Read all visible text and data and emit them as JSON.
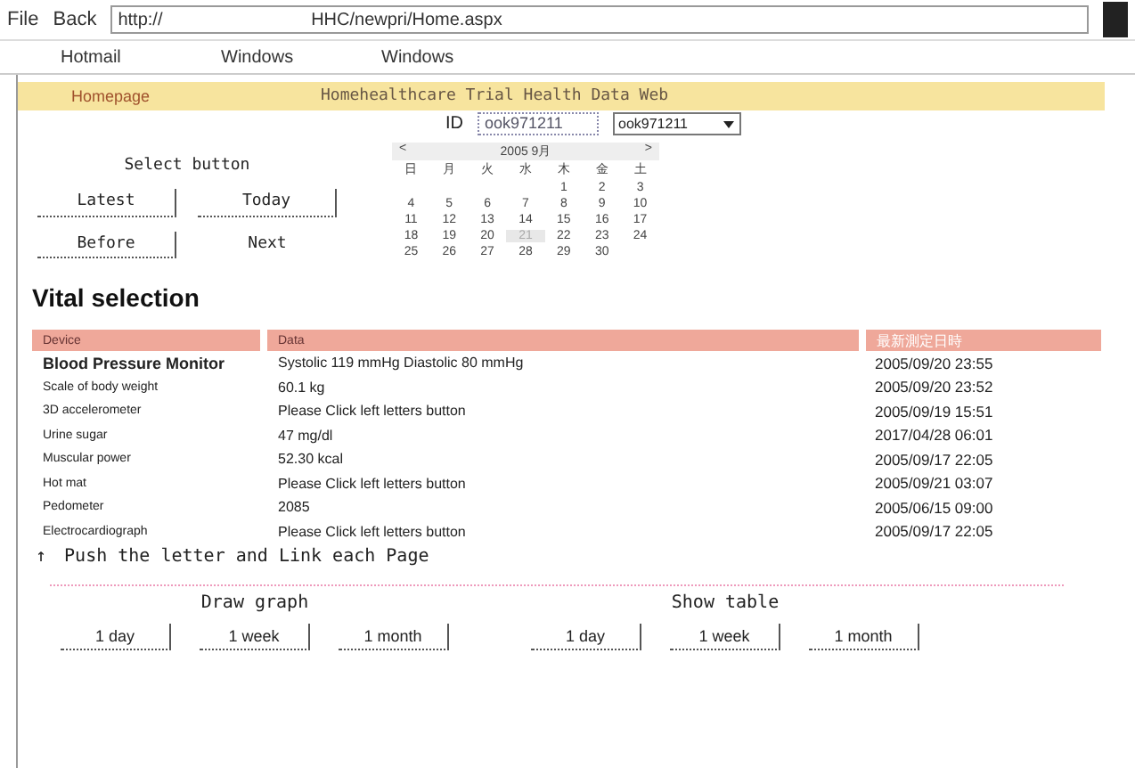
{
  "browser": {
    "menu": "File",
    "back": "Back",
    "address": "http://                              HHC/newpri/Home.aspx",
    "links": [
      "Hotmail",
      "Windows",
      "Windows"
    ]
  },
  "header": {
    "home_link": "Homepage",
    "title": "Homehealthcare Trial   Health Data Web"
  },
  "id_row": {
    "label": "ID",
    "value": "ook971211",
    "select": "ook971211"
  },
  "select_panel": {
    "caption": "Select button",
    "buttons": [
      {
        "label": "Latest",
        "kind": "button"
      },
      {
        "label": "Today",
        "kind": "button"
      },
      {
        "label": "Before",
        "kind": "button"
      },
      {
        "label": "Next",
        "kind": "text"
      }
    ]
  },
  "calendar": {
    "prev": "<",
    "month": "2005 9月",
    "next": ">",
    "weekdays": [
      "日",
      "月",
      "火",
      "水",
      "木",
      "金",
      "土"
    ],
    "weeks": [
      [
        {
          "day": "1",
          "selected": false
        },
        {
          "day": "2",
          "selected": false
        },
        {
          "day": "3",
          "selected": false
        }
      ],
      [
        {
          "day": "4",
          "selected": false
        },
        {
          "day": "5",
          "selected": false
        },
        {
          "day": "6",
          "selected": false
        },
        {
          "day": "7",
          "selected": false
        },
        {
          "day": "8",
          "selected": false
        },
        {
          "day": "9",
          "selected": false
        },
        {
          "day": "10",
          "selected": false
        }
      ],
      [
        {
          "day": "11",
          "selected": false
        },
        {
          "day": "12",
          "selected": false
        },
        {
          "day": "13",
          "selected": false
        },
        {
          "day": "14",
          "selected": false
        },
        {
          "day": "15",
          "selected": false
        },
        {
          "day": "16",
          "selected": false
        },
        {
          "day": "17",
          "selected": false
        }
      ],
      [
        {
          "day": "18",
          "selected": false
        },
        {
          "day": "19",
          "selected": false
        },
        {
          "day": "20",
          "selected": false
        },
        {
          "day": "21",
          "selected": true
        },
        {
          "day": "22",
          "selected": false
        },
        {
          "day": "23",
          "selected": false
        },
        {
          "day": "24",
          "selected": false
        }
      ],
      [
        {
          "day": "25",
          "selected": false
        },
        {
          "day": "26",
          "selected": false
        },
        {
          "day": "27",
          "selected": false
        },
        {
          "day": "28",
          "selected": false
        },
        {
          "day": "29",
          "selected": false
        },
        {
          "day": "30",
          "selected": false
        }
      ]
    ]
  },
  "heading": "Vital selection",
  "table": {
    "columns": [
      "Device",
      "Data",
      "最新測定日時"
    ],
    "rows": [
      {
        "device": "Blood Pressure Monitor",
        "data": "Systolic 119 mmHg Diastolic   80 mmHg",
        "time": "2005/09/20 23:55",
        "bold": true
      },
      {
        "device": "Scale of body weight",
        "data": "60.1 kg",
        "time": "2005/09/20 23:52",
        "bold": false
      },
      {
        "device": "3D accelerometer",
        "data": "Please Click left letters button",
        "time": "2005/09/19 15:51",
        "bold": false
      },
      {
        "device": "Urine sugar",
        "data": "47 mg/dl",
        "time": "2017/04/28 06:01",
        "bold": false
      },
      {
        "device": "Muscular power",
        "data": "52.30 kcal",
        "time": "2005/09/17 22:05",
        "bold": false
      },
      {
        "device": "Hot mat",
        "data": "Please Click left letters button",
        "time": "2005/09/21 03:07",
        "bold": false
      },
      {
        "device": "Pedometer",
        "data": "2085",
        "time": "2005/06/15 09:00",
        "bold": false
      },
      {
        "device": "Electrocardiograph",
        "data": "Please Click left letters button",
        "time": "2005/09/17 22:05",
        "bold": false
      }
    ]
  },
  "note": {
    "mark": "↑",
    "text": "Push the letter and Link each Page"
  },
  "graph": {
    "title": "Draw graph",
    "buttons": [
      "1 day",
      "1 week",
      "1 month"
    ]
  },
  "table_view": {
    "title": "Show table",
    "buttons": [
      "1 day",
      "1 week",
      "1 month"
    ]
  }
}
